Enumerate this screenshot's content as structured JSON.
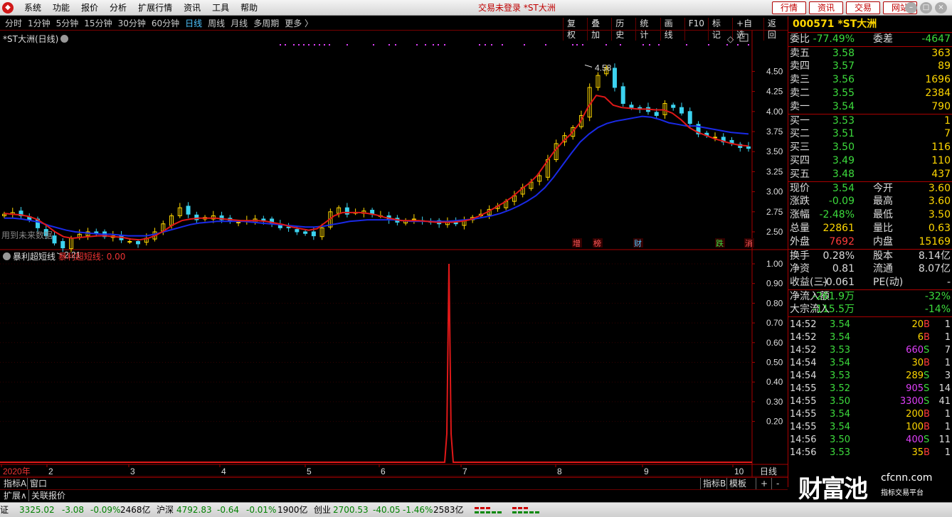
{
  "app": {
    "title": "交易未登录 *ST大洲",
    "menu": [
      "系统",
      "功能",
      "报价",
      "分析",
      "扩展行情",
      "资讯",
      "工具",
      "帮助"
    ],
    "top_buttons": [
      "行情",
      "资讯",
      "交易",
      "网站"
    ]
  },
  "periods": {
    "items": [
      "分时",
      "1分钟",
      "5分钟",
      "15分钟",
      "30分钟",
      "60分钟",
      "日线",
      "周线",
      "月线",
      "多周期",
      "更多 〉"
    ],
    "active": "日线"
  },
  "chart_tools": [
    "复权",
    "叠加",
    "历史",
    "统计",
    "画线",
    "F10",
    "标记",
    "+自选",
    "返回"
  ],
  "main_chart": {
    "title": "*ST大洲(日线)",
    "high_label": "4.58",
    "low_label": "2.21",
    "future_label": "用到未来数据",
    "event_labels": [
      "增",
      "榜",
      "财",
      "跌",
      "消"
    ],
    "y_ticks": [
      "4.50",
      "4.25",
      "4.00",
      "3.75",
      "3.50",
      "3.25",
      "3.00",
      "2.75",
      "2.50"
    ]
  },
  "indicator": {
    "name": "暴利超短线",
    "value_label": "暴利超短线: 0.00",
    "y_ticks": [
      "1.00",
      "0.90",
      "0.80",
      "0.70",
      "0.60",
      "0.50",
      "0.40",
      "0.30",
      "0.20"
    ]
  },
  "x_axis": {
    "labels": [
      "2020年",
      "2",
      "3",
      "4",
      "5",
      "6",
      "7",
      "8",
      "9",
      "10"
    ],
    "period_label": "日线"
  },
  "chart_data": {
    "type": "candlestick",
    "x_range": [
      "2020-01",
      "2020-10"
    ],
    "ylim": [
      2.2,
      4.6
    ],
    "ma_fast_color": "#e01818",
    "ma_slow_color": "#1a2ae6",
    "candles_close": [
      2.72,
      2.74,
      2.7,
      2.65,
      2.55,
      2.45,
      2.36,
      2.3,
      2.42,
      2.47,
      2.5,
      2.48,
      2.44,
      2.45,
      2.4,
      2.38,
      2.35,
      2.42,
      2.5,
      2.6,
      2.7,
      2.8,
      2.72,
      2.65,
      2.68,
      2.7,
      2.65,
      2.63,
      2.62,
      2.64,
      2.66,
      2.64,
      2.6,
      2.55,
      2.55,
      2.5,
      2.48,
      2.45,
      2.55,
      2.75,
      2.8,
      2.72,
      2.74,
      2.76,
      2.72,
      2.7,
      2.65,
      2.62,
      2.64,
      2.66,
      2.63,
      2.62,
      2.6,
      2.62,
      2.6,
      2.65,
      2.68,
      2.72,
      2.78,
      2.82,
      2.88,
      2.95,
      3.05,
      3.12,
      3.2,
      3.4,
      3.6,
      3.7,
      3.8,
      3.95,
      4.3,
      4.45,
      4.55,
      4.3,
      4.1,
      4.05,
      4.03,
      4.0,
      3.95,
      4.1,
      4.05,
      3.98,
      3.85,
      3.72,
      3.7,
      3.68,
      3.62,
      3.6,
      3.55,
      3.54
    ],
    "ma_fast": [
      2.73,
      2.72,
      2.71,
      2.69,
      2.65,
      2.58,
      2.5,
      2.44,
      2.42,
      2.43,
      2.44,
      2.45,
      2.45,
      2.44,
      2.43,
      2.41,
      2.4,
      2.42,
      2.46,
      2.52,
      2.59,
      2.64,
      2.66,
      2.67,
      2.67,
      2.67,
      2.66,
      2.65,
      2.64,
      2.64,
      2.64,
      2.63,
      2.61,
      2.59,
      2.56,
      2.54,
      2.52,
      2.54,
      2.62,
      2.7,
      2.74,
      2.74,
      2.74,
      2.73,
      2.71,
      2.68,
      2.66,
      2.64,
      2.64,
      2.64,
      2.63,
      2.62,
      2.62,
      2.62,
      2.63,
      2.65,
      2.69,
      2.74,
      2.8,
      2.86,
      2.93,
      3.02,
      3.1,
      3.2,
      3.35,
      3.5,
      3.62,
      3.72,
      3.85,
      4.05,
      4.2,
      4.18,
      4.08,
      4.05,
      4.04,
      4.03,
      4.03,
      4.02,
      4.02,
      3.98,
      3.9,
      3.8,
      3.74,
      3.7,
      3.66,
      3.63,
      3.6,
      3.58,
      3.57
    ],
    "ma_slow": [
      2.67,
      2.67,
      2.66,
      2.64,
      2.62,
      2.58,
      2.55,
      2.52,
      2.5,
      2.49,
      2.48,
      2.47,
      2.47,
      2.46,
      2.45,
      2.45,
      2.45,
      2.47,
      2.5,
      2.53,
      2.56,
      2.59,
      2.61,
      2.62,
      2.63,
      2.63,
      2.63,
      2.63,
      2.62,
      2.61,
      2.6,
      2.59,
      2.58,
      2.57,
      2.56,
      2.56,
      2.57,
      2.59,
      2.61,
      2.63,
      2.64,
      2.65,
      2.65,
      2.65,
      2.65,
      2.64,
      2.63,
      2.63,
      2.63,
      2.63,
      2.63,
      2.64,
      2.65,
      2.66,
      2.68,
      2.7,
      2.73,
      2.77,
      2.82,
      2.88,
      2.95,
      3.05,
      3.18,
      3.33,
      3.48,
      3.62,
      3.72,
      3.8,
      3.85,
      3.88,
      3.9,
      3.92,
      3.94,
      3.93,
      3.9,
      3.86,
      3.84,
      3.82,
      3.82,
      3.8,
      3.78,
      3.76,
      3.74,
      3.73,
      3.72
    ]
  },
  "quote": {
    "code_name": "000571 *ST大洲",
    "weibi": {
      "label": "委比",
      "value": "-77.49%",
      "label2": "委差",
      "value2": "-4647"
    },
    "asks": [
      {
        "label": "卖五",
        "price": "3.58",
        "vol": "363"
      },
      {
        "label": "卖四",
        "price": "3.57",
        "vol": "89"
      },
      {
        "label": "卖三",
        "price": "3.56",
        "vol": "1696"
      },
      {
        "label": "卖二",
        "price": "3.55",
        "vol": "2384"
      },
      {
        "label": "卖一",
        "price": "3.54",
        "vol": "790"
      }
    ],
    "bids": [
      {
        "label": "买一",
        "price": "3.53",
        "vol": "1"
      },
      {
        "label": "买二",
        "price": "3.51",
        "vol": "7"
      },
      {
        "label": "买三",
        "price": "3.50",
        "vol": "116"
      },
      {
        "label": "买四",
        "price": "3.49",
        "vol": "110"
      },
      {
        "label": "买五",
        "price": "3.48",
        "vol": "437"
      }
    ],
    "stats": [
      {
        "l1": "现价",
        "v1": "3.54",
        "c1": "green",
        "l2": "今开",
        "v2": "3.60",
        "c2": "yellow"
      },
      {
        "l1": "涨跌",
        "v1": "-0.09",
        "c1": "green",
        "l2": "最高",
        "v2": "3.60",
        "c2": "yellow"
      },
      {
        "l1": "涨幅",
        "v1": "-2.48%",
        "c1": "green",
        "l2": "最低",
        "v2": "3.50",
        "c2": "yellow"
      },
      {
        "l1": "总量",
        "v1": "22861",
        "c1": "yellow",
        "l2": "量比",
        "v2": "0.63",
        "c2": "yellow"
      },
      {
        "l1": "外盘",
        "v1": "7692",
        "c1": "red",
        "l2": "内盘",
        "v2": "15169",
        "c2": "yellow"
      }
    ],
    "fund": [
      {
        "l1": "换手",
        "v1": "0.28%",
        "l2": "股本",
        "v2": "8.14亿"
      },
      {
        "l1": "净资",
        "v1": "0.81",
        "l2": "流通",
        "v2": "8.07亿"
      },
      {
        "l1": "收益(三)",
        "v1": "-0.061",
        "l2": "PE(动)",
        "v2": "-"
      }
    ],
    "flow": [
      {
        "l1": "净流入额",
        "v1": "-261.9万",
        "v2": "-32%"
      },
      {
        "l1": "大宗流入",
        "v1": "-115.5万",
        "v2": "-14%"
      }
    ],
    "ticks": [
      {
        "t": "14:52",
        "p": "3.54",
        "v": "20",
        "bs": "B",
        "n": "1"
      },
      {
        "t": "14:52",
        "p": "3.54",
        "v": "6",
        "bs": "B",
        "n": "1"
      },
      {
        "t": "14:52",
        "p": "3.53",
        "v": "660",
        "bs": "S",
        "n": "7"
      },
      {
        "t": "14:54",
        "p": "3.54",
        "v": "30",
        "bs": "B",
        "n": "1"
      },
      {
        "t": "14:54",
        "p": "3.53",
        "v": "289",
        "bs": "S",
        "n": "3"
      },
      {
        "t": "14:55",
        "p": "3.52",
        "v": "905",
        "bs": "S",
        "n": "14"
      },
      {
        "t": "14:55",
        "p": "3.50",
        "v": "3300",
        "bs": "S",
        "n": "41"
      },
      {
        "t": "14:55",
        "p": "3.54",
        "v": "200",
        "bs": "B",
        "n": "1"
      },
      {
        "t": "14:55",
        "p": "3.54",
        "v": "100",
        "bs": "B",
        "n": "1"
      },
      {
        "t": "14:56",
        "p": "3.50",
        "v": "400",
        "bs": "S",
        "n": "11"
      },
      {
        "t": "14:56",
        "p": "3.53",
        "v": "35",
        "bs": "B",
        "n": "1"
      }
    ]
  },
  "bottom": {
    "tabs_row1": [
      "指标A",
      "窗口"
    ],
    "tabs_row1_right": [
      "指标B",
      "模板",
      "+",
      "-"
    ],
    "tabs_row2": [
      "扩展∧",
      "关联报价"
    ]
  },
  "statusbar": {
    "sh_label": "证",
    "sh_val": "3325.02",
    "sh_chg": "-3.08",
    "sh_pct": "-0.09%",
    "sh_amt": "2468亿",
    "sz_label": "沪深",
    "sz_val": "4792.83",
    "sz_chg": "-0.64",
    "sz_pct": "-0.01%",
    "sz_amt": "1900亿",
    "cy_label": "创业",
    "cy_val": "2700.53",
    "cy_chg": "-40.05",
    "cy_pct": "-1.46%",
    "cy_amt": "2583亿"
  },
  "watermark": {
    "brand": "财富池",
    "site": "cfcnn.com",
    "tag": "指标交易平台"
  }
}
